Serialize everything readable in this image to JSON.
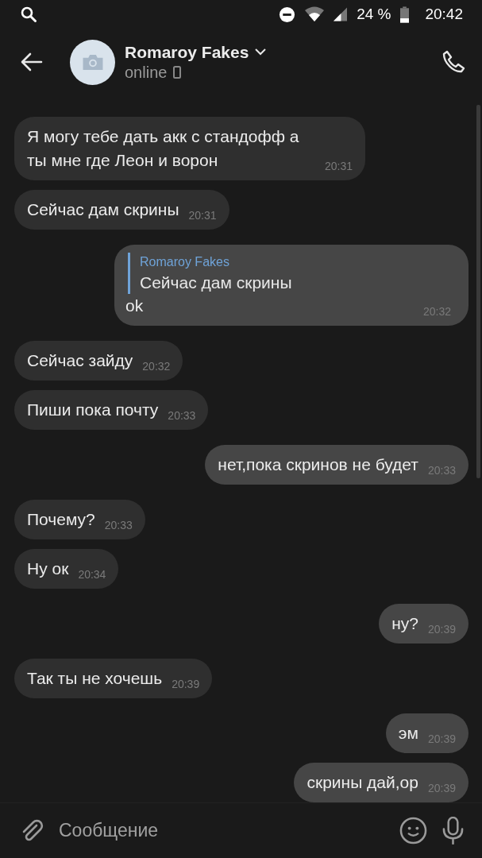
{
  "status_bar": {
    "battery": "24 %",
    "time": "20:42"
  },
  "header": {
    "name": "Romaroy Fakes",
    "status": "online"
  },
  "messages": [
    {
      "outgoing": false,
      "text": "Я могу тебе дать акк с стандофф а ты мне где Леон и ворон",
      "time": "20:31"
    },
    {
      "outgoing": false,
      "text": "Сейчас дам скрины",
      "time": "20:31"
    },
    {
      "outgoing": true,
      "reply": {
        "author": "Romaroy Fakes",
        "text": "Сейчас дам скрины"
      },
      "text": "ok",
      "time": "20:32"
    },
    {
      "outgoing": false,
      "text": "Сейчас зайду",
      "time": "20:32"
    },
    {
      "outgoing": false,
      "text": "Пиши пока почту",
      "time": "20:33"
    },
    {
      "outgoing": true,
      "text": "нет,пока скринов не будет",
      "time": "20:33"
    },
    {
      "outgoing": false,
      "text": "Почему?",
      "time": "20:33"
    },
    {
      "outgoing": false,
      "text": "Ну ок",
      "time": "20:34"
    },
    {
      "outgoing": true,
      "text": "ну?",
      "time": "20:39"
    },
    {
      "outgoing": false,
      "text": "Так ты не хочешь",
      "time": "20:39"
    },
    {
      "outgoing": true,
      "text": "эм",
      "time": "20:39"
    },
    {
      "outgoing": true,
      "text": "скрины дай,ор",
      "time": "20:39"
    }
  ],
  "composer": {
    "placeholder": "Сообщение"
  }
}
